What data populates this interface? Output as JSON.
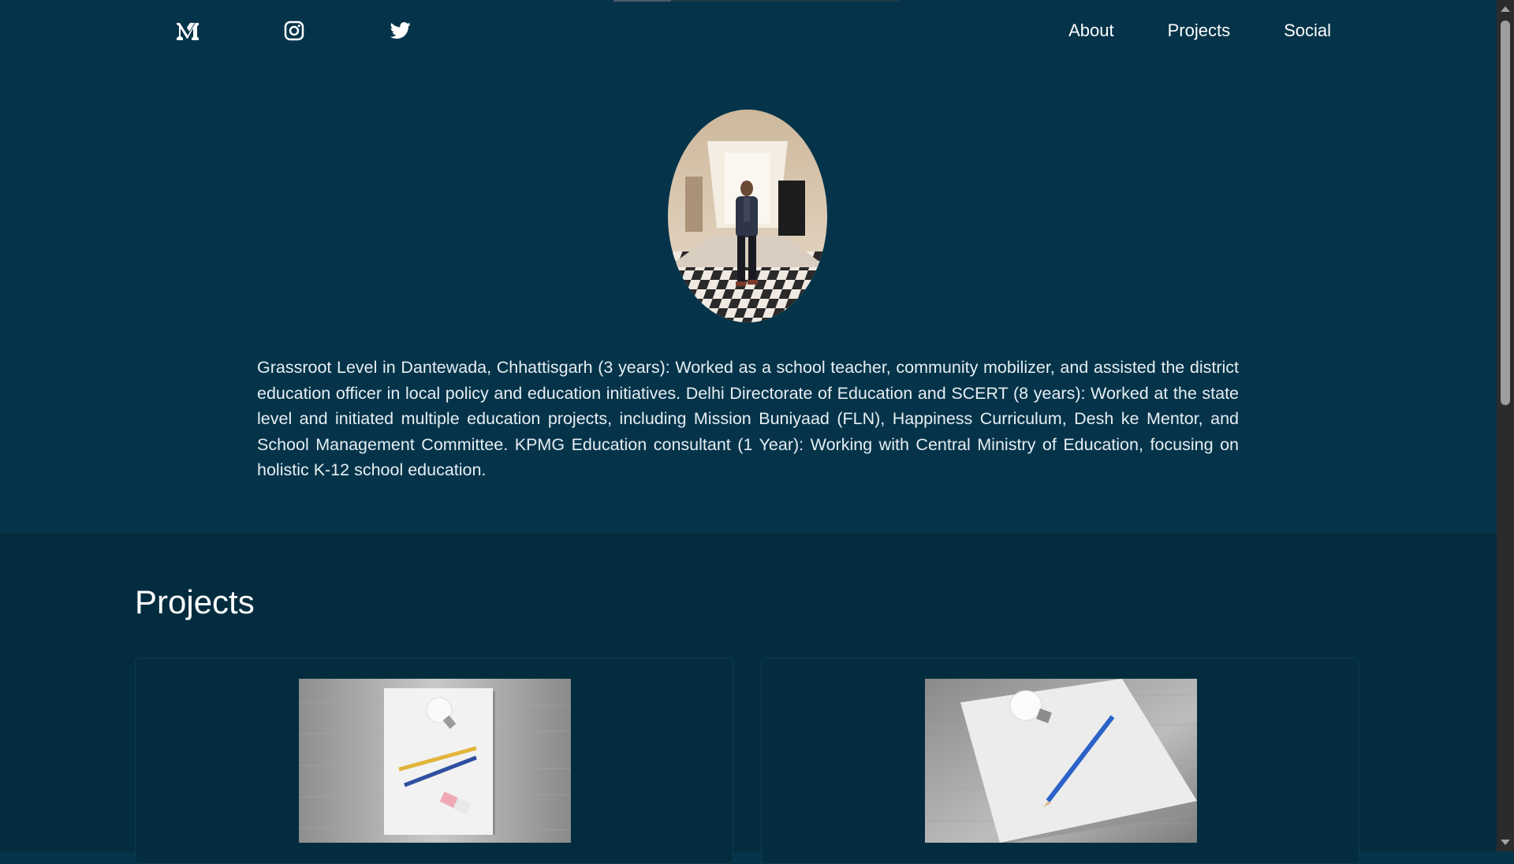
{
  "header": {
    "social_icons": [
      "medium-icon",
      "instagram-icon",
      "twitter-icon"
    ],
    "nav": [
      {
        "label": "About"
      },
      {
        "label": "Projects"
      },
      {
        "label": "Social"
      }
    ]
  },
  "hero": {
    "avatar": "profile-photo",
    "bio": "Grassroot Level in Dantewada, Chhattisgarh (3 years): Worked as a school teacher, community mobilizer, and assisted the district education officer in local policy and education initiatives. Delhi Directorate of Education and SCERT (8 years): Worked at the state level and initiated multiple education projects, including Mission Buniyaad (FLN), Happiness Curriculum, Desh ke Mentor, and School Management Committee. KPMG Education consultant (1 Year): Working with Central Ministry of Education, focusing on holistic K-12 school education."
  },
  "projects": {
    "title": "Projects",
    "cards": [
      {
        "image": "paper-bulb-pencils-image"
      },
      {
        "image": "paper-bulb-pencil-image"
      }
    ]
  },
  "colors": {
    "hero_bg": "#05344a",
    "projects_bg": "#042c3f",
    "text": "#ffffff"
  }
}
